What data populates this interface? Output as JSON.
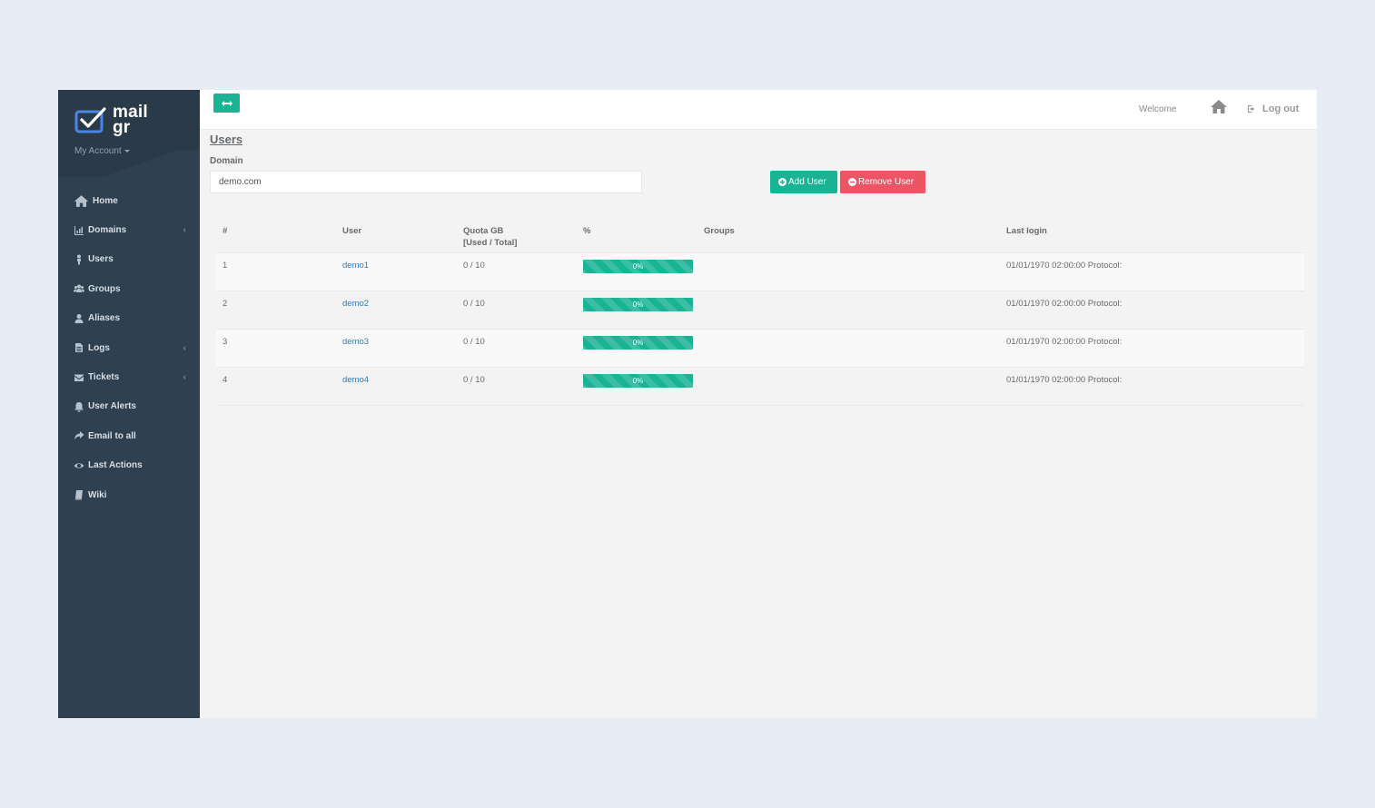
{
  "sidebar": {
    "logo_line1": "mail",
    "logo_line2": "gr",
    "account_label": "My Account",
    "items": [
      {
        "label": "Home",
        "icon": "home-icon"
      },
      {
        "label": "Domains",
        "icon": "bar-chart-icon",
        "has_submenu": true
      },
      {
        "label": "Users",
        "icon": "user-icon"
      },
      {
        "label": "Groups",
        "icon": "users-icon"
      },
      {
        "label": "Aliases",
        "icon": "user-icon"
      },
      {
        "label": "Logs",
        "icon": "file-icon",
        "has_submenu": true
      },
      {
        "label": "Tickets",
        "icon": "envelope-icon",
        "has_submenu": true
      },
      {
        "label": "User Alerts",
        "icon": "bell-icon"
      },
      {
        "label": "Email to all",
        "icon": "share-icon"
      },
      {
        "label": "Last Actions",
        "icon": "eye-icon"
      },
      {
        "label": "Wiki",
        "icon": "book-icon"
      }
    ],
    "submenu_chevron": "‹"
  },
  "topbar": {
    "welcome": "Welcome",
    "logout_label": "Log out"
  },
  "page": {
    "title": "Users",
    "domain_label": "Domain",
    "domain_value": "demo.com",
    "add_user_label": "Add User",
    "remove_user_label": "Remove User"
  },
  "table": {
    "headers": {
      "num": "#",
      "user": "User",
      "quota_line1": "Quota GB",
      "quota_line2": "[Used / Total]",
      "pct": "%",
      "groups": "Groups",
      "last_login": "Last login"
    },
    "rows": [
      {
        "num": "1",
        "user": "demo1",
        "quota": "0 / 10",
        "pct_label": "0%",
        "usage_pct": 0,
        "groups": "",
        "last_login": "01/01/1970 02:00:00 Protocol:"
      },
      {
        "num": "2",
        "user": "demo2",
        "quota": "0 / 10",
        "pct_label": "0%",
        "usage_pct": 0,
        "groups": "",
        "last_login": "01/01/1970 02:00:00 Protocol:"
      },
      {
        "num": "3",
        "user": "demo3",
        "quota": "0 / 10",
        "pct_label": "0%",
        "usage_pct": 0,
        "groups": "",
        "last_login": "01/01/1970 02:00:00 Protocol:"
      },
      {
        "num": "4",
        "user": "demo4",
        "quota": "0 / 10",
        "pct_label": "0%",
        "usage_pct": 0,
        "groups": "",
        "last_login": "01/01/1970 02:00:00 Protocol:"
      }
    ]
  },
  "colors": {
    "sidebar_bg": "#2f4050",
    "accent": "#1ab394",
    "danger": "#ed5565",
    "link": "#337ab7",
    "page_bg": "#e8ecf4"
  }
}
